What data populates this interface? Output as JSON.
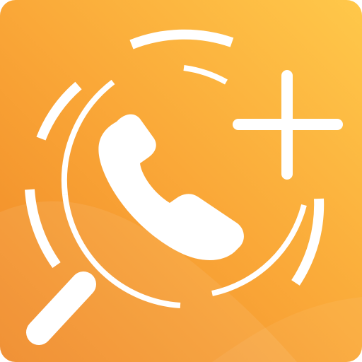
{
  "app_icon": {
    "icon_name": "phone-search-add-icon",
    "background_gradient": [
      "#FFC84A",
      "#F9A436",
      "#EF8826"
    ],
    "foreground_color": "#FFFFFF",
    "elements": {
      "handset": "phone-handset-icon",
      "plus": "plus-icon",
      "rings": "segmented-rings",
      "lens": "magnifier-handle-icon"
    }
  }
}
